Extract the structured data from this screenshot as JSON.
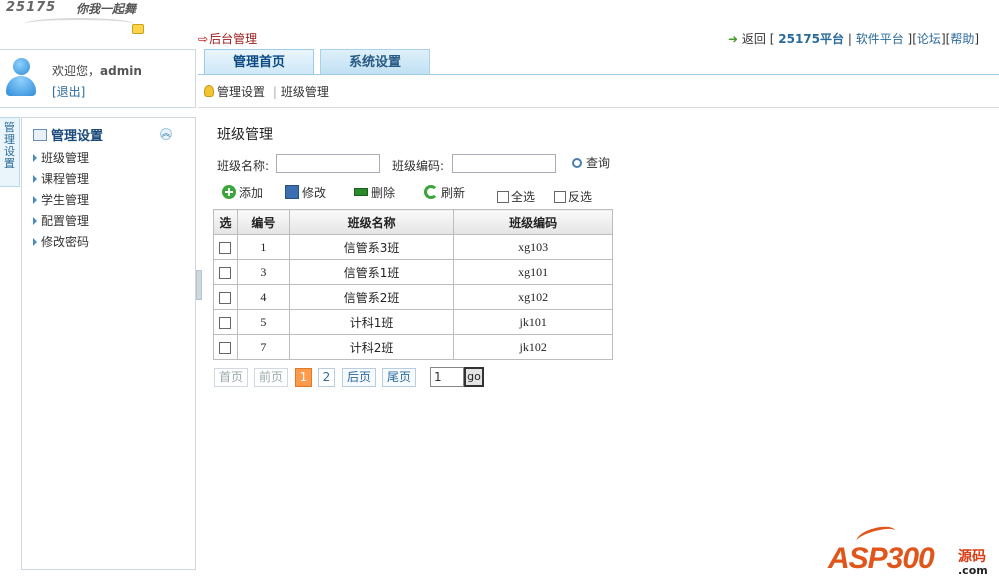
{
  "logo": {
    "text1": "25175",
    "text2": "你我一起舞"
  },
  "header": {
    "backend_link": "后台管理",
    "back_label": "返回",
    "links": [
      {
        "label": "25175平台"
      },
      {
        "label": "软件平台"
      },
      {
        "label": "论坛"
      },
      {
        "label": "帮助"
      }
    ]
  },
  "tabs": [
    {
      "label": "管理首页",
      "active": true
    },
    {
      "label": "系统设置",
      "active": false
    }
  ],
  "breadcrumb": {
    "section": "管理设置",
    "sep": "|",
    "page": "班级管理"
  },
  "user": {
    "welcome": "欢迎您，",
    "name": "admin",
    "logout": "[退出]"
  },
  "sidebar": {
    "vertical_tab": "管理设置",
    "header": "管理设置",
    "items": [
      {
        "label": "班级管理"
      },
      {
        "label": "课程管理"
      },
      {
        "label": "学生管理"
      },
      {
        "label": "配置管理"
      },
      {
        "label": "修改密码"
      }
    ]
  },
  "main": {
    "title": "班级管理",
    "search": {
      "name_label": "班级名称:",
      "name_value": "",
      "code_label": "班级编码:",
      "code_value": "",
      "query_label": "查询"
    },
    "toolbar": {
      "add": "添加",
      "edit": "修改",
      "delete": "删除",
      "refresh": "刷新",
      "select_all": "全选",
      "invert": "反选"
    },
    "table": {
      "headers": [
        "选",
        "编号",
        "班级名称",
        "班级编码"
      ],
      "rows": [
        {
          "id": "1",
          "name": "信管系3班",
          "code": "xg103"
        },
        {
          "id": "3",
          "name": "信管系1班",
          "code": "xg101"
        },
        {
          "id": "4",
          "name": "信管系2班",
          "code": "xg102"
        },
        {
          "id": "5",
          "name": "计科1班",
          "code": "jk101"
        },
        {
          "id": "7",
          "name": "计科2班",
          "code": "jk102"
        }
      ]
    },
    "pager": {
      "first": "首页",
      "prev": "前页",
      "page1": "1",
      "page2": "2",
      "next": "后页",
      "last": "尾页",
      "input_value": "1",
      "go": "go"
    }
  },
  "watermark": {
    "brand": "ASP300",
    "tag": "源码",
    "domain": ".com"
  },
  "colors": {
    "accent": "#1a4a7a",
    "link": "#2a6a9a",
    "current_page": "#ff9a4a",
    "backend": "#9b1b1b"
  }
}
